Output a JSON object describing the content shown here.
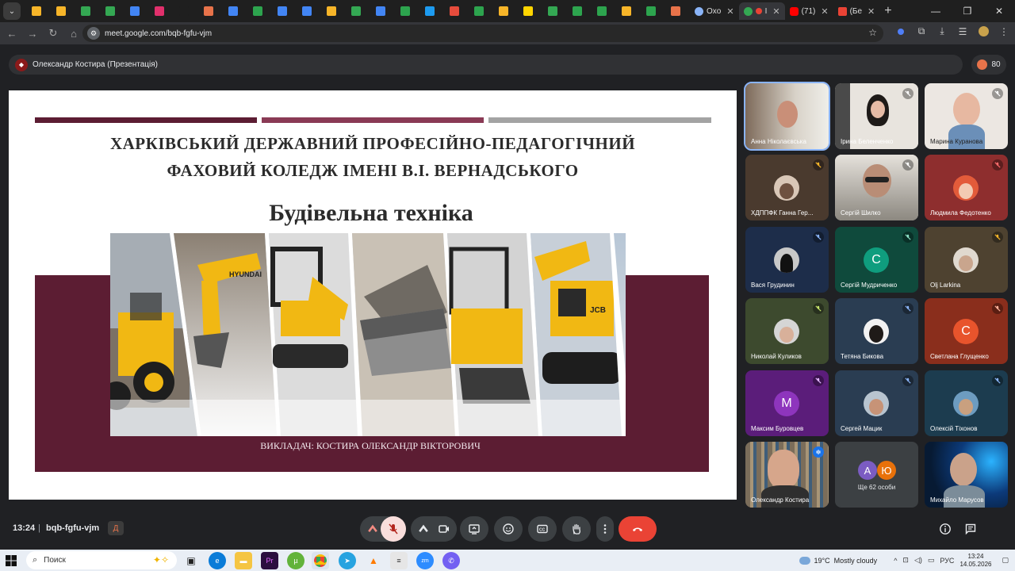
{
  "browser": {
    "url": "meet.google.com/bqb-fgfu-vjm",
    "favicon_colors": [
      "#f7b529",
      "#f7b529",
      "#34a853",
      "#34a853",
      "#4285f4",
      "#e1306c",
      "#1f1f1f",
      "#e8734a",
      "#4285f4",
      "#2da44e",
      "#4285f4",
      "#4285f4",
      "#f7b529",
      "#34a853",
      "#4285f4",
      "#2da44e",
      "#1d9bf0",
      "#e74c3c",
      "#2da44e",
      "#f7b529",
      "#ffd500",
      "#34a853",
      "#2da44e",
      "#2da44e",
      "#f7b529",
      "#2da44e",
      "#e8734a"
    ],
    "tabs": [
      {
        "label": "Oxo",
        "icon_color": "#8ab4f8"
      },
      {
        "label": "I",
        "icon_color": "#34a853",
        "active": true
      },
      {
        "label": "(71)",
        "icon_color": "#ff0000"
      },
      {
        "label": "(Бе",
        "icon_color": "#ea4335"
      }
    ]
  },
  "meet": {
    "presenter": "Олександр Костира (Презентація)",
    "participant_count": "80",
    "time": "13:24",
    "separator": "|",
    "code": "bqb-fgfu-vjm",
    "badge": "Д"
  },
  "slide": {
    "title_line1": "ХАРКІВСЬКИЙ ДЕРЖАВНИЙ ПРОФЕСІЙНО-ПЕДАГОГІЧНИЙ",
    "title_line2": "ФАХОВИЙ КОЛЕДЖ ІМЕНІ  В.І. ВЕРНАДСЬКОГО",
    "subject": "Будівельна техніка",
    "lecturer": "ВИКЛАДАЧ: КОСТИРА ОЛЕКСАНДР ВІКТОРОВИЧ",
    "accent_colors": [
      "#5c1d33",
      "#8a3a55",
      "#a3a3a3"
    ]
  },
  "participants": [
    {
      "name": "Анна Ніколаєвська",
      "active": true
    },
    {
      "name": "Ірина Беленченко",
      "muted": true
    },
    {
      "name": "Марина Куранова",
      "muted": true
    },
    {
      "name": "ХДППФК Ганна Гер...",
      "muted": true
    },
    {
      "name": "Сергій Шилко",
      "muted": true
    },
    {
      "name": "Людмила Федотенко",
      "muted": true
    },
    {
      "name": "Вася Грудинин",
      "muted": true
    },
    {
      "name": "Сергій Мудриченко",
      "muted": true,
      "initial": "С"
    },
    {
      "name": "Olj Larkina",
      "muted": true
    },
    {
      "name": "Николай Куликов",
      "muted": true
    },
    {
      "name": "Тетяна Бикова",
      "muted": true
    },
    {
      "name": "Светлана Глущенко",
      "muted": true,
      "initial": "С"
    },
    {
      "name": "Максим Буровцев",
      "muted": true,
      "initial": "М"
    },
    {
      "name": "Сергей Мацик",
      "muted": true
    },
    {
      "name": "Олексій Тіхонов",
      "muted": true
    },
    {
      "name": "Олександр Костира",
      "speaking": true
    },
    {
      "name": "Ще 62 особи",
      "initials": [
        "А",
        "Ю"
      ]
    },
    {
      "name": "Михайло Марусов"
    }
  ],
  "taskbar": {
    "search_placeholder": "Поиск",
    "weather_temp": "19°C",
    "weather_text": "Mostly cloudy",
    "lang": "РУС",
    "clock_time": "13:24",
    "clock_date": "14.05.2026"
  }
}
